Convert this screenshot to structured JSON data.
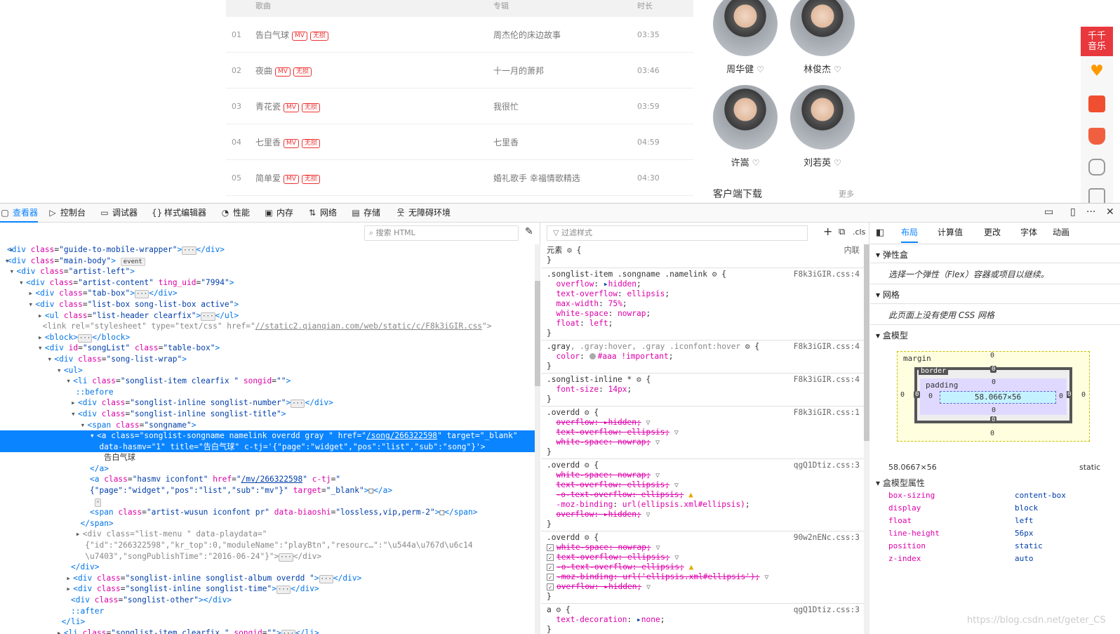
{
  "page": {
    "song_header": {
      "col_song": "歌曲",
      "col_album": "专辑",
      "col_time": "时长"
    },
    "songs": [
      {
        "num": "01",
        "name": "告白气球",
        "mv": "MV",
        "lossless": "无损",
        "album": "周杰伦的床边故事",
        "time": "03:35"
      },
      {
        "num": "02",
        "name": "夜曲",
        "mv": "MV",
        "lossless": "无损",
        "album": "十一月的萧邦",
        "time": "03:46"
      },
      {
        "num": "03",
        "name": "青花瓷",
        "mv": "MV",
        "lossless": "无损",
        "album": "我很忙",
        "time": "03:59"
      },
      {
        "num": "04",
        "name": "七里香",
        "mv": "MV",
        "lossless": "无损",
        "album": "七里香",
        "time": "04:59"
      },
      {
        "num": "05",
        "name": "简单爱",
        "mv": "MV",
        "lossless": "无损",
        "album": "婚礼歌手 幸福情歌精选",
        "time": "04:30"
      }
    ],
    "artists": [
      "周华健",
      "林俊杰",
      "许嵩",
      "刘若英"
    ],
    "client_download": "客户端下载",
    "more": "更多",
    "logo_text": "千千\n音乐"
  },
  "devtools": {
    "tabs": [
      "查看器",
      "控制台",
      "调试器",
      "样式编辑器",
      "性能",
      "内存",
      "网络",
      "存储",
      "无障碍环境"
    ],
    "search_html_placeholder": "搜索 HTML",
    "filter_styles_placeholder": "过滤样式",
    "cls_label": ".cls",
    "layout_tabs": [
      "布局",
      "计算值",
      "更改",
      "字体",
      "动画"
    ],
    "flex_title": "弹性盒",
    "flex_body": "选择一个弹性（Flex）容器或项目以继续。",
    "grid_title": "网格",
    "grid_body": "此页面上没有使用 CSS 网格",
    "boxmodel_title": "盒模型",
    "boxmodel": {
      "margin_label": "margin",
      "border_label": "border",
      "padding_label": "padding",
      "content": "58.0667×56",
      "zero": "0",
      "size_readout": "58.0667×56",
      "position_readout": "static"
    },
    "props_title": "盒模型属性",
    "props": [
      {
        "k": "box-sizing",
        "v": "content-box"
      },
      {
        "k": "display",
        "v": "block"
      },
      {
        "k": "float",
        "v": "left"
      },
      {
        "k": "line-height",
        "v": "56px"
      },
      {
        "k": "position",
        "v": "static"
      },
      {
        "k": "z-index",
        "v": "auto"
      }
    ],
    "element_rule_label": "元素",
    "inline_label": "内联"
  },
  "watermark": "https://blog.csdn.net/geter_CS"
}
